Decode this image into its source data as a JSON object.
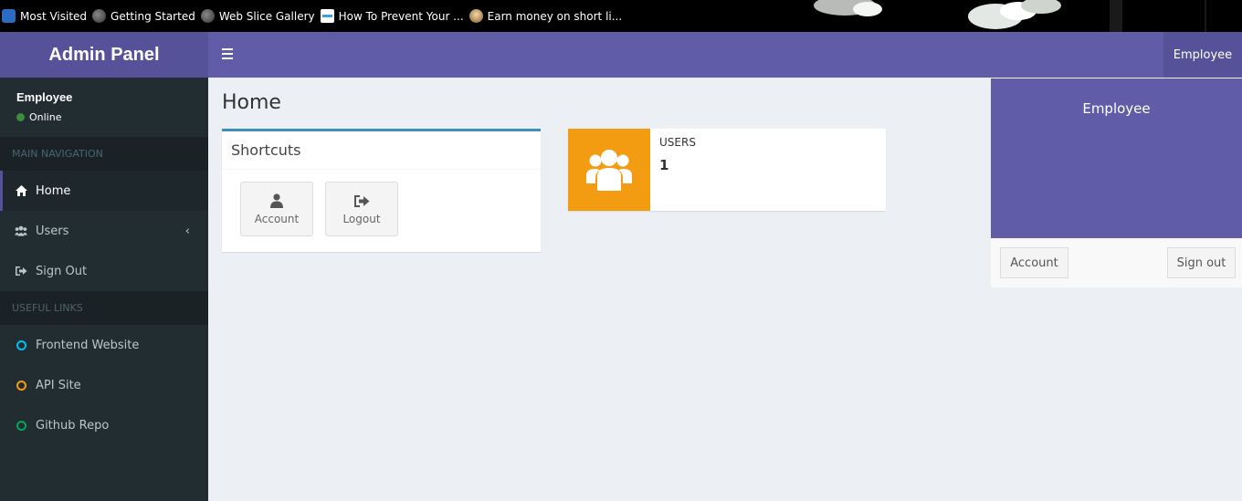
{
  "browser": {
    "bookmarks": [
      {
        "label": "Most Visited",
        "icon": "search-icon"
      },
      {
        "label": "Getting Started",
        "icon": "globe-icon"
      },
      {
        "label": "Web Slice Gallery",
        "icon": "globe-icon"
      },
      {
        "label": "How To Prevent Your ...",
        "icon": "web-slice-icon"
      },
      {
        "label": "Earn money on short li...",
        "icon": "money-icon"
      }
    ]
  },
  "brand": {
    "title": "Admin Panel",
    "color": "#605ca8"
  },
  "user_panel": {
    "name": "Employee",
    "status": "Online"
  },
  "sidebar": {
    "main_header": "MAIN NAVIGATION",
    "items": [
      {
        "label": "Home",
        "icon": "home-icon",
        "active": true
      },
      {
        "label": "Users",
        "icon": "users-icon",
        "caret": "‹"
      },
      {
        "label": "Sign Out",
        "icon": "sign-out-icon"
      }
    ],
    "links_header": "USEFUL LINKS",
    "links": [
      {
        "label": "Frontend Website",
        "color": "#00c0ef"
      },
      {
        "label": "API Site",
        "color": "#f39c12"
      },
      {
        "label": "Github Repo",
        "color": "#00a65a"
      }
    ]
  },
  "topbar": {
    "menu_icon": "hamburger-icon",
    "user_label": "Employee"
  },
  "main": {
    "title": "Home",
    "shortcuts": {
      "title": "Shortcuts",
      "buttons": [
        {
          "label": "Account",
          "icon": "user-icon"
        },
        {
          "label": "Logout",
          "icon": "sign-out-icon"
        }
      ]
    },
    "stats": {
      "label": "USERS",
      "value": "1",
      "color": "#f39c12",
      "icon": "users-icon"
    }
  },
  "user_menu": {
    "name": "Employee",
    "account_label": "Account",
    "signout_label": "Sign out"
  }
}
